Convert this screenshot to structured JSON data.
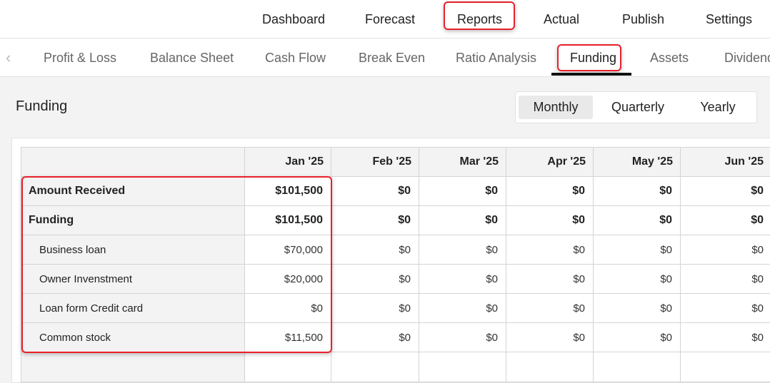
{
  "top_nav": {
    "items": [
      {
        "label": "Dashboard"
      },
      {
        "label": "Forecast"
      },
      {
        "label": "Reports"
      },
      {
        "label": "Actual"
      },
      {
        "label": "Publish"
      },
      {
        "label": "Settings"
      }
    ],
    "active": "Reports"
  },
  "sub_tabs": {
    "items": [
      {
        "label": "Profit & Loss"
      },
      {
        "label": "Balance Sheet"
      },
      {
        "label": "Cash Flow"
      },
      {
        "label": "Break Even"
      },
      {
        "label": "Ratio Analysis"
      },
      {
        "label": "Funding"
      },
      {
        "label": "Assets"
      },
      {
        "label": "Dividend"
      }
    ],
    "active": "Funding"
  },
  "page": {
    "title": "Funding"
  },
  "period": {
    "options": [
      {
        "label": "Monthly"
      },
      {
        "label": "Quarterly"
      },
      {
        "label": "Yearly"
      }
    ],
    "selected": "Monthly"
  },
  "table": {
    "columns": [
      "Jan '25",
      "Feb '25",
      "Mar '25",
      "Apr '25",
      "May '25",
      "Jun '25"
    ],
    "rows": [
      {
        "label": "Amount Received",
        "values": [
          "$101,500",
          "$0",
          "$0",
          "$0",
          "$0",
          "$0"
        ]
      },
      {
        "label": "Funding",
        "values": [
          "$101,500",
          "$0",
          "$0",
          "$0",
          "$0",
          "$0"
        ]
      },
      {
        "label": "Business loan",
        "values": [
          "$70,000",
          "$0",
          "$0",
          "$0",
          "$0",
          "$0"
        ]
      },
      {
        "label": "Owner Invenstment",
        "values": [
          "$20,000",
          "$0",
          "$0",
          "$0",
          "$0",
          "$0"
        ]
      },
      {
        "label": "Loan form Credit card",
        "values": [
          "$0",
          "$0",
          "$0",
          "$0",
          "$0",
          "$0"
        ]
      },
      {
        "label": "Common stock",
        "values": [
          "$11,500",
          "$0",
          "$0",
          "$0",
          "$0",
          "$0"
        ]
      }
    ]
  },
  "colors": {
    "highlight": "#e8202a",
    "active_underline": "#111111",
    "background": "#f3f3f3"
  }
}
